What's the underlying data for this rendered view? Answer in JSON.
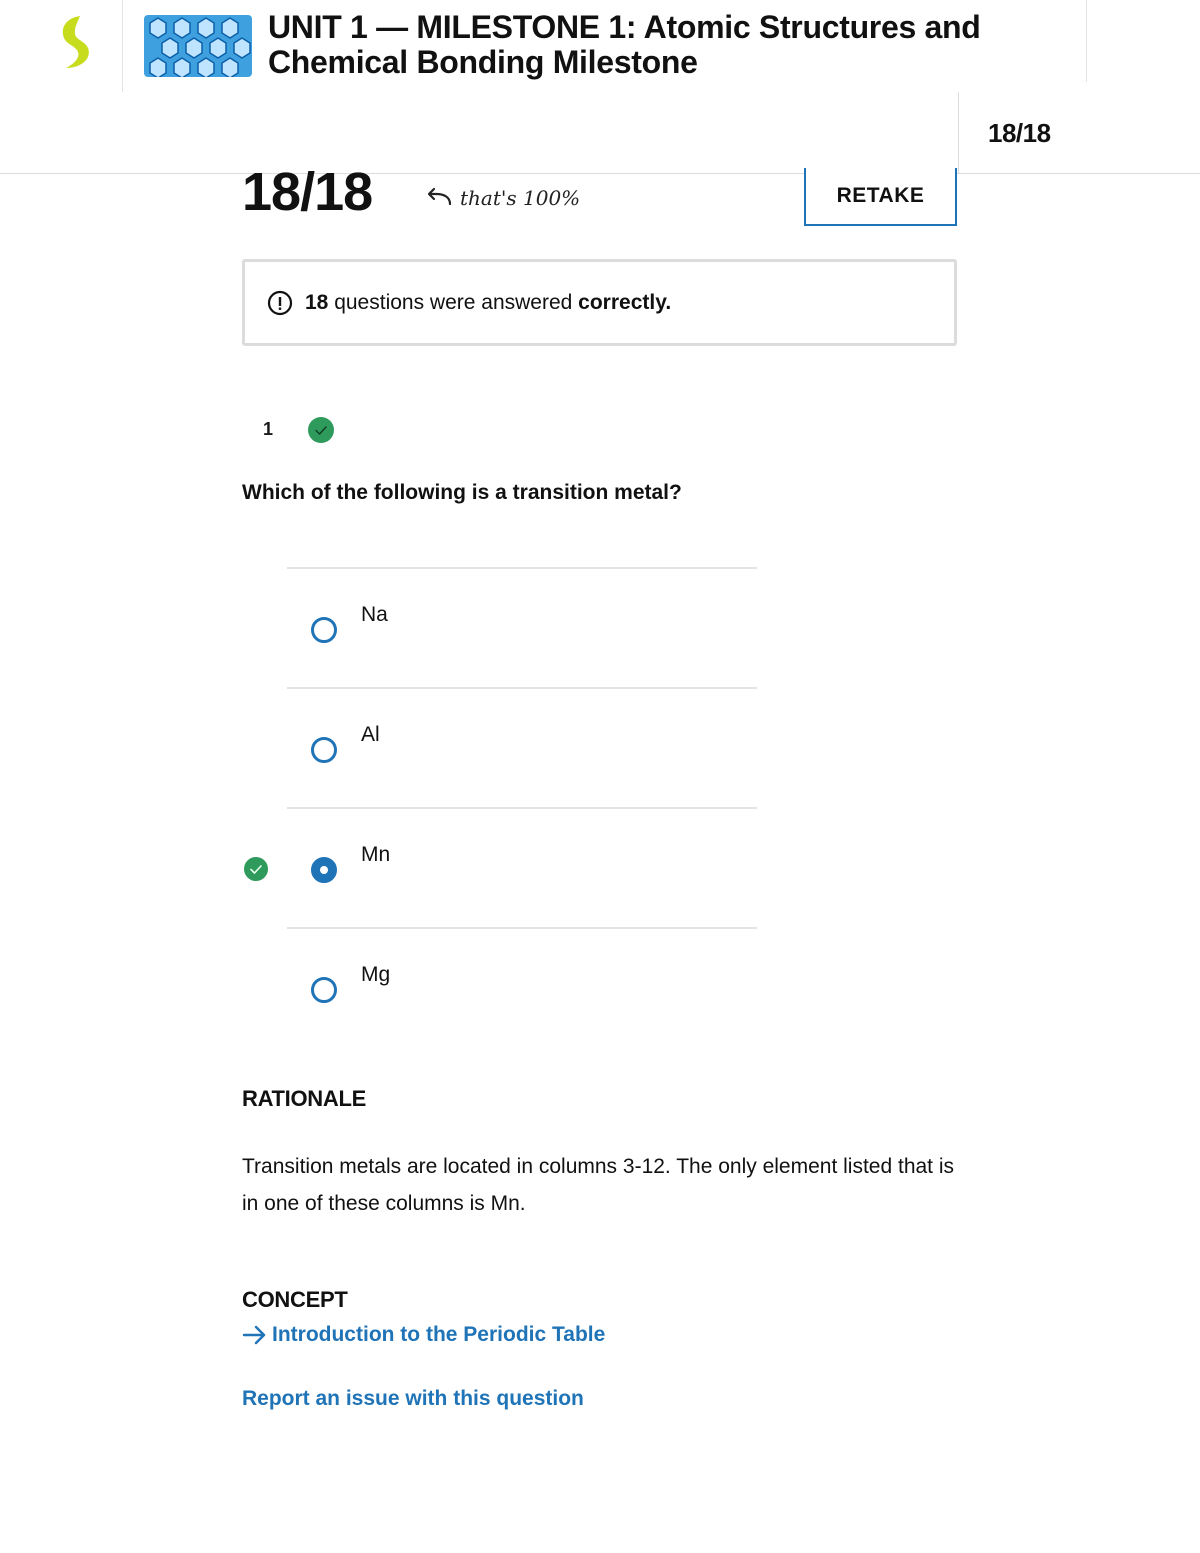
{
  "header": {
    "unit_title": "UNIT 1 — MILESTONE 1: Atomic Structures and Chemical Bonding Milestone",
    "score_summary": "18/18",
    "brand_color": "#c8dc1e"
  },
  "score": {
    "value": "18/18",
    "annotation": "that's 100%",
    "retake_label": "RETAKE",
    "info_count": "18",
    "info_text": " questions were answered ",
    "info_emphasis": "correctly."
  },
  "question": {
    "number": "1",
    "status": "correct",
    "text": "Which of the following is a transition metal?",
    "options": [
      {
        "label": "Na",
        "selected": false
      },
      {
        "label": "Al",
        "selected": false
      },
      {
        "label": "Mn",
        "selected": true
      },
      {
        "label": "Mg",
        "selected": false
      }
    ]
  },
  "rationale": {
    "heading": "RATIONALE",
    "text": "Transition metals are located in columns 3-12. The only element listed that is in one of these columns is Mn."
  },
  "concept": {
    "heading": "CONCEPT",
    "link": "Introduction to the Periodic Table"
  },
  "report_link": "Report an issue with this question",
  "colors": {
    "accent": "#1f73b7",
    "success": "#2e9a5b"
  }
}
